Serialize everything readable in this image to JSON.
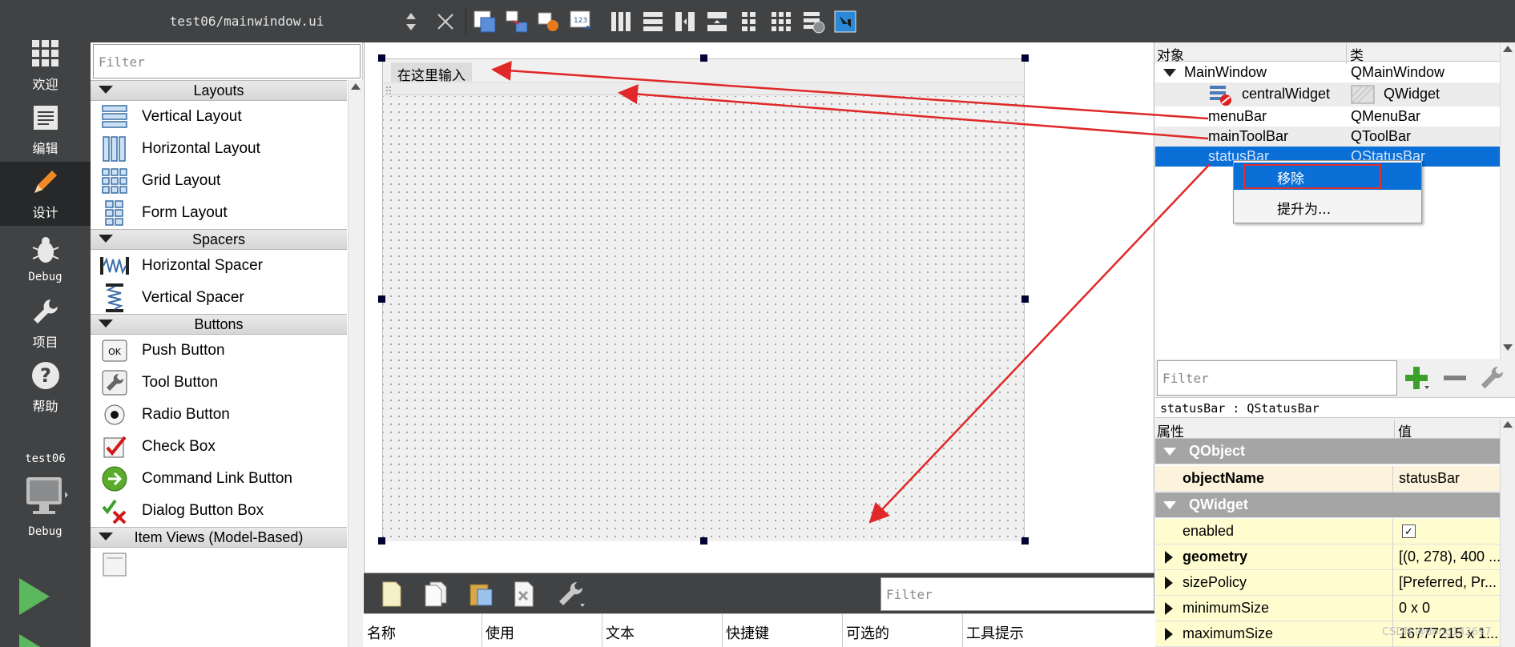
{
  "modebar": {
    "items": [
      {
        "label": "欢迎",
        "icon": "welcome-grid-icon"
      },
      {
        "label": "编辑",
        "icon": "edit-document-icon"
      },
      {
        "label": "设计",
        "icon": "design-pencil-icon"
      },
      {
        "label": "Debug",
        "icon": "debug-bug-icon"
      },
      {
        "label": "项目",
        "icon": "project-wrench-icon"
      },
      {
        "label": "帮助",
        "icon": "help-question-icon"
      }
    ],
    "project_name": "test06",
    "kit_label": "Debug"
  },
  "topbar": {
    "file_title": "test06/mainwindow.ui",
    "icons": [
      "edit-widgets-icon",
      "edit-signals-slots-icon",
      "edit-buddies-icon",
      "edit-tab-order-icon",
      "layout-horizontal-icon",
      "layout-vertical-icon",
      "layout-horizontal-splitter-icon",
      "layout-vertical-splitter-icon",
      "layout-form-icon",
      "layout-grid-icon",
      "break-layout-icon",
      "adjust-size-icon"
    ]
  },
  "widgetbox": {
    "filter_placeholder": "Filter",
    "categories": [
      {
        "name": "Layouts",
        "items": [
          "Vertical Layout",
          "Horizontal Layout",
          "Grid Layout",
          "Form Layout"
        ]
      },
      {
        "name": "Spacers",
        "items": [
          "Horizontal Spacer",
          "Vertical Spacer"
        ]
      },
      {
        "name": "Buttons",
        "items": [
          "Push Button",
          "Tool Button",
          "Radio Button",
          "Check Box",
          "Command Link Button",
          "Dialog Button Box"
        ]
      },
      {
        "name": "Item Views (Model-Based)",
        "items": []
      }
    ]
  },
  "form": {
    "menu_placeholder": "在这里输入"
  },
  "action_editor": {
    "filter_placeholder": "Filter",
    "columns": [
      "名称",
      "使用",
      "文本",
      "快捷键",
      "可选的",
      "工具提示"
    ]
  },
  "object_inspector": {
    "headers": [
      "对象",
      "类"
    ],
    "rows": [
      {
        "object": "MainWindow",
        "class": "QMainWindow"
      },
      {
        "object": "centralWidget",
        "class": "QWidget"
      },
      {
        "object": "menuBar",
        "class": "QMenuBar"
      },
      {
        "object": "mainToolBar",
        "class": "QToolBar"
      },
      {
        "object": "statusBar",
        "class": "QStatusBar"
      }
    ],
    "context_menu": [
      "移除",
      "提升为..."
    ]
  },
  "property_editor": {
    "filter_placeholder": "Filter",
    "object_label": "statusBar : QStatusBar",
    "headers": [
      "属性",
      "值"
    ],
    "groups": {
      "qobject": "QObject",
      "qwidget": "QWidget"
    },
    "props": {
      "objectName": {
        "key": "objectName",
        "value": "statusBar"
      },
      "enabled": {
        "key": "enabled",
        "value": "✓"
      },
      "geometry": {
        "key": "geometry",
        "value": "[(0, 278), 400 ..."
      },
      "sizePolicy": {
        "key": "sizePolicy",
        "value": "[Preferred, Pr..."
      },
      "minimumSize": {
        "key": "minimumSize",
        "value": "0 x 0"
      },
      "maximumSize": {
        "key": "maximumSize",
        "value": "16777215 x 1..."
      }
    }
  },
  "watermark": "CSDN @dong132697",
  "colors": {
    "dark_chrome": "#404244",
    "selection": "#0a6fd6",
    "annotation_red": "#e02828"
  }
}
